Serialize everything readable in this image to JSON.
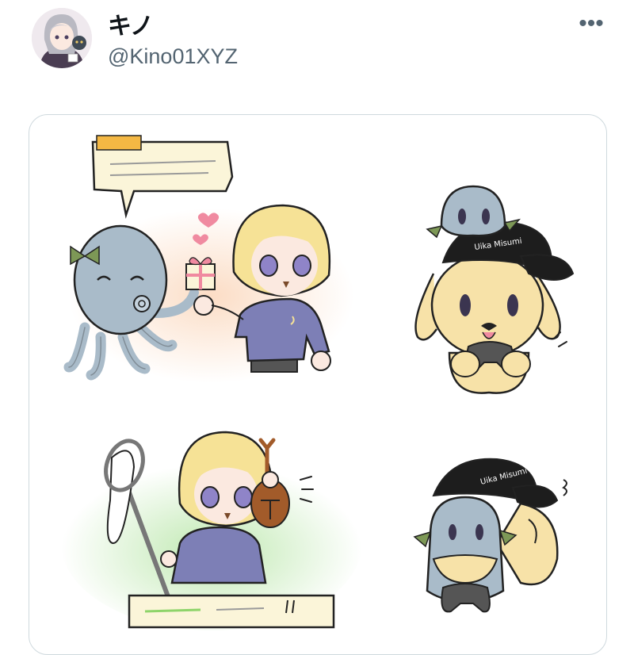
{
  "tweet": {
    "display_name": "キノ",
    "handle": "@Kino01XYZ",
    "more_label": "•••",
    "avatar_icon": "user-avatar-icon"
  },
  "media": {
    "cap_text": "Uika Misumi",
    "colors": {
      "blonde": "#f6e296",
      "shirt": "#7d7fb6",
      "ghost": "#a9bbc9",
      "dog": "#f7e2a8",
      "cap": "#1d1d1d",
      "bow": "#7d9856",
      "heart": "#f08aa0"
    }
  }
}
